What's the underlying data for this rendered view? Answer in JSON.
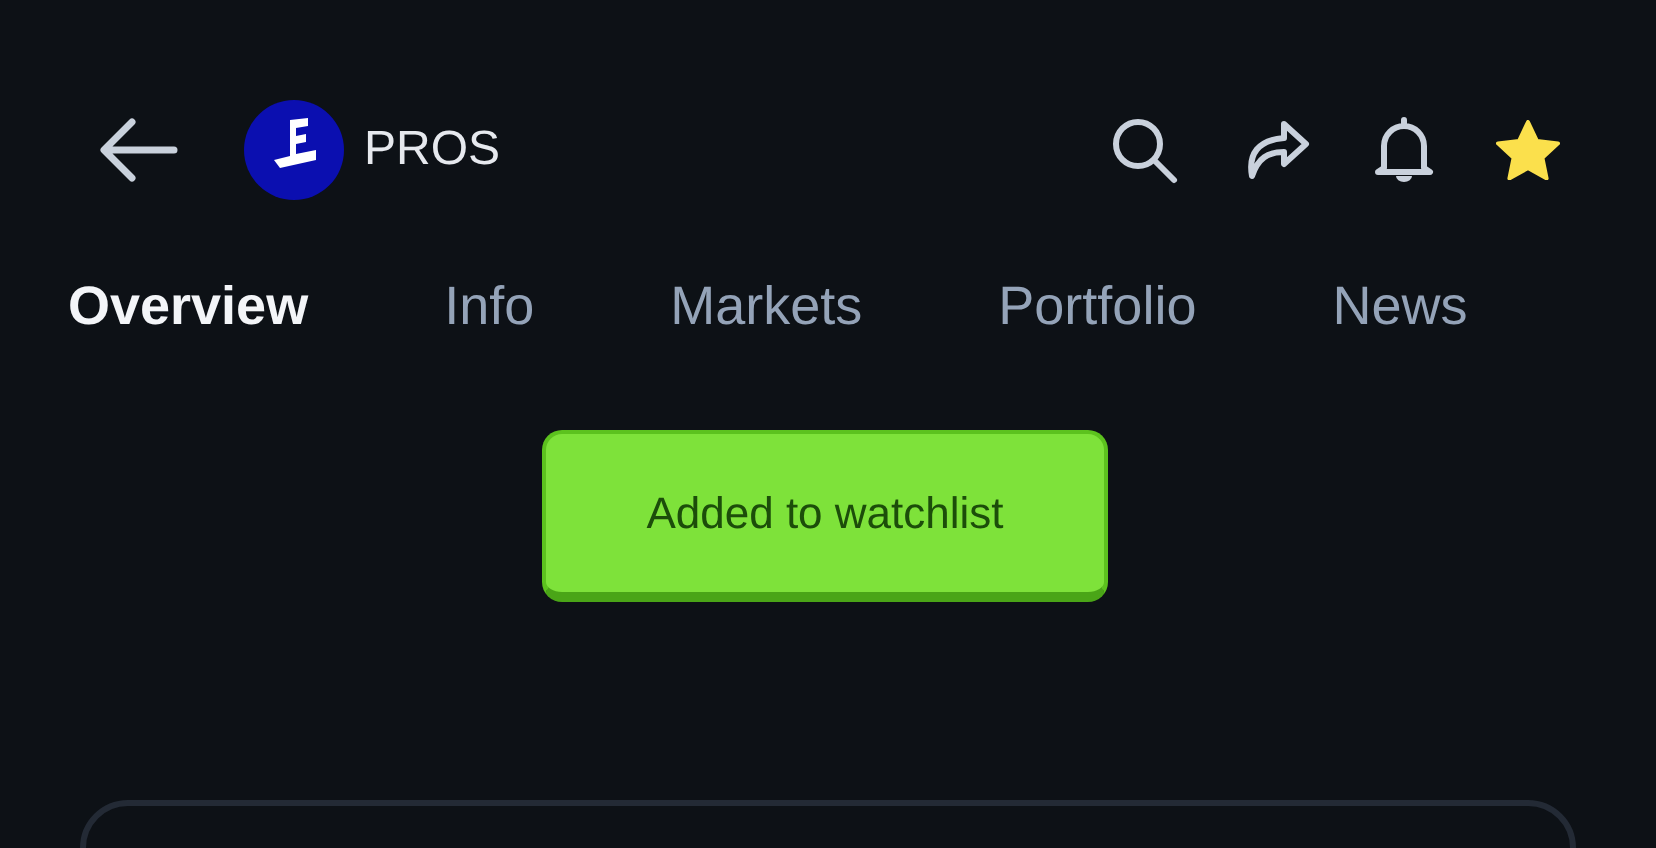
{
  "header": {
    "title": "PROS",
    "watchlisted": true
  },
  "tabs": [
    {
      "label": "Overview",
      "selected": true
    },
    {
      "label": "Info",
      "selected": false
    },
    {
      "label": "Markets",
      "selected": false
    },
    {
      "label": "Portfolio",
      "selected": false
    },
    {
      "label": "News",
      "selected": false
    }
  ],
  "toast": {
    "message": "Added to watchlist"
  }
}
